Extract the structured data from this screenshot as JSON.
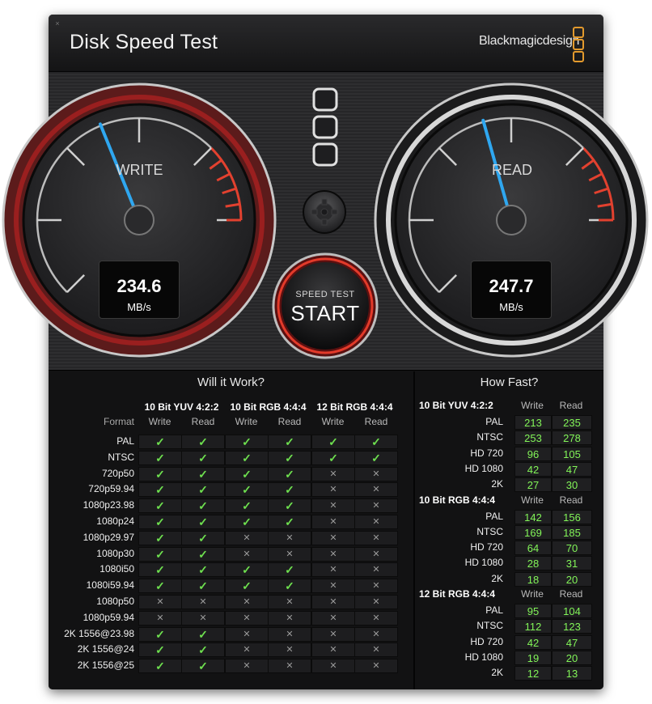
{
  "window": {
    "close_glyph": "×",
    "title": "Disk Speed Test",
    "brand": "Blackmagicdesign"
  },
  "gauges": {
    "write": {
      "label": "WRITE",
      "value": "234.6",
      "unit": "MB/s",
      "needle_fraction": 0.502
    },
    "read": {
      "label": "READ",
      "value": "247.7",
      "unit": "MB/s",
      "needle_fraction": 0.53
    },
    "start_button": {
      "line1": "SPEED TEST",
      "line2": "START"
    }
  },
  "will_it_work": {
    "title": "Will it Work?",
    "format_header": "Format",
    "groups": [
      "10 Bit YUV 4:2:2",
      "10 Bit RGB 4:4:4",
      "12 Bit RGB 4:4:4"
    ],
    "sub_headers": [
      "Write",
      "Read"
    ],
    "yes_glyph": "✓",
    "no_glyph": "✕",
    "rows": [
      {
        "format": "PAL",
        "checks": [
          1,
          1,
          1,
          1,
          1,
          1
        ]
      },
      {
        "format": "NTSC",
        "checks": [
          1,
          1,
          1,
          1,
          1,
          1
        ]
      },
      {
        "format": "720p50",
        "checks": [
          1,
          1,
          1,
          1,
          0,
          0
        ]
      },
      {
        "format": "720p59.94",
        "checks": [
          1,
          1,
          1,
          1,
          0,
          0
        ]
      },
      {
        "format": "1080p23.98",
        "checks": [
          1,
          1,
          1,
          1,
          0,
          0
        ]
      },
      {
        "format": "1080p24",
        "checks": [
          1,
          1,
          1,
          1,
          0,
          0
        ]
      },
      {
        "format": "1080p29.97",
        "checks": [
          1,
          1,
          0,
          0,
          0,
          0
        ]
      },
      {
        "format": "1080p30",
        "checks": [
          1,
          1,
          0,
          0,
          0,
          0
        ]
      },
      {
        "format": "1080i50",
        "checks": [
          1,
          1,
          1,
          1,
          0,
          0
        ]
      },
      {
        "format": "1080i59.94",
        "checks": [
          1,
          1,
          1,
          1,
          0,
          0
        ]
      },
      {
        "format": "1080p50",
        "checks": [
          0,
          0,
          0,
          0,
          0,
          0
        ]
      },
      {
        "format": "1080p59.94",
        "checks": [
          0,
          0,
          0,
          0,
          0,
          0
        ]
      },
      {
        "format": "2K 1556@23.98",
        "checks": [
          1,
          1,
          0,
          0,
          0,
          0
        ]
      },
      {
        "format": "2K 1556@24",
        "checks": [
          1,
          1,
          0,
          0,
          0,
          0
        ]
      },
      {
        "format": "2K 1556@25",
        "checks": [
          1,
          1,
          0,
          0,
          0,
          0
        ]
      }
    ]
  },
  "how_fast": {
    "title": "How Fast?",
    "sub_headers": [
      "Write",
      "Read"
    ],
    "groups": [
      {
        "name": "10 Bit YUV 4:2:2",
        "rows": [
          {
            "format": "PAL",
            "write": "213",
            "read": "235"
          },
          {
            "format": "NTSC",
            "write": "253",
            "read": "278"
          },
          {
            "format": "HD 720",
            "write": "96",
            "read": "105"
          },
          {
            "format": "HD 1080",
            "write": "42",
            "read": "47"
          },
          {
            "format": "2K",
            "write": "27",
            "read": "30"
          }
        ]
      },
      {
        "name": "10 Bit RGB 4:4:4",
        "rows": [
          {
            "format": "PAL",
            "write": "142",
            "read": "156"
          },
          {
            "format": "NTSC",
            "write": "169",
            "read": "185"
          },
          {
            "format": "HD 720",
            "write": "64",
            "read": "70"
          },
          {
            "format": "HD 1080",
            "write": "28",
            "read": "31"
          },
          {
            "format": "2K",
            "write": "18",
            "read": "20"
          }
        ]
      },
      {
        "name": "12 Bit RGB 4:4:4",
        "rows": [
          {
            "format": "PAL",
            "write": "95",
            "read": "104"
          },
          {
            "format": "NTSC",
            "write": "112",
            "read": "123"
          },
          {
            "format": "HD 720",
            "write": "42",
            "read": "47"
          },
          {
            "format": "HD 1080",
            "write": "19",
            "read": "20"
          },
          {
            "format": "2K",
            "write": "12",
            "read": "13"
          }
        ]
      }
    ]
  },
  "colors": {
    "check_green": "#6ee04f",
    "number_green": "#82f558",
    "write_ring": "#8a1d1d",
    "needle_blue": "#2fa7f0",
    "brand_orange": "#e39a2d"
  }
}
